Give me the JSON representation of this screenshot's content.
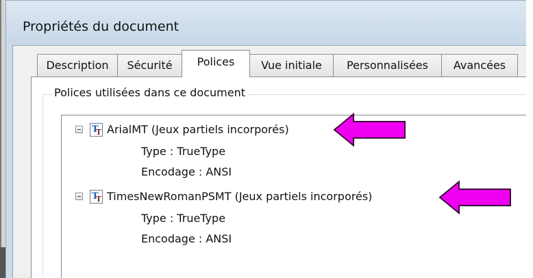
{
  "window": {
    "title": "Propriétés du document"
  },
  "tabs": [
    {
      "label": "Description"
    },
    {
      "label": "Sécurité"
    },
    {
      "label": "Polices"
    },
    {
      "label": "Vue initiale"
    },
    {
      "label": "Personnalisées"
    },
    {
      "label": "Avancées"
    }
  ],
  "active_tab": "Polices",
  "fonts_group": {
    "title": "Polices utilisées dans ce document",
    "fonts": [
      {
        "name": "ArialMT (Jeux partiels incorporés)",
        "type": "Type : TrueType",
        "encoding": "Encodage : ANSI"
      },
      {
        "name": "TimesNewRomanPSMT (Jeux partiels incorporés)",
        "type": "Type : TrueType",
        "encoding": "Encodage : ANSI"
      }
    ]
  },
  "icons": {
    "font": "truetype-font-icon",
    "expander": "collapse-minus-icon",
    "annotation": "magenta-arrow-left-icon"
  },
  "colors": {
    "arrow_fill": "#f000f0",
    "arrow_stroke": "#3a0a3a",
    "frame": "#cfdbe8",
    "dialog_bg": "#f0f0f0"
  }
}
